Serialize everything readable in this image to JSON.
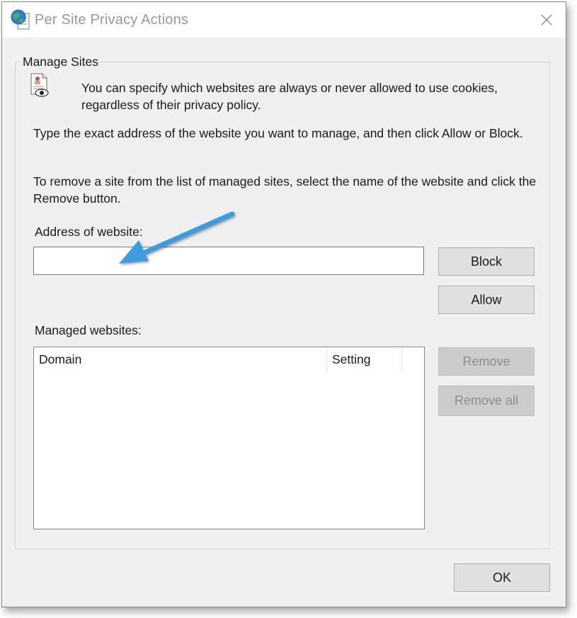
{
  "window": {
    "title": "Per Site Privacy Actions",
    "icon": "globe-document-icon",
    "close_icon": "close-icon"
  },
  "group": {
    "legend": "Manage Sites",
    "icon": "privacy-document-eye-icon",
    "intro": "You can specify which websites are always or never allowed to use cookies, regardless of their privacy policy.",
    "instructions_add": "Type the exact address of the website you want to manage, and then click Allow or Block.",
    "instructions_remove": "To remove a site from the list of managed sites, select the name of the website and click the Remove button."
  },
  "address": {
    "label": "Address of website:",
    "value": "",
    "placeholder": ""
  },
  "buttons": {
    "block": "Block",
    "allow": "Allow",
    "remove": "Remove",
    "remove_all": "Remove all",
    "ok": "OK"
  },
  "managed": {
    "label": "Managed websites:",
    "columns": [
      "Domain",
      "Setting"
    ],
    "rows": []
  },
  "annotation": {
    "arrow_color": "#3d9be0"
  },
  "colors": {
    "dialog_bg": "#f0f0f0",
    "button_bg": "#e1e1e1",
    "disabled_button_bg": "#cccccc",
    "disabled_text": "#8d8d8d"
  }
}
